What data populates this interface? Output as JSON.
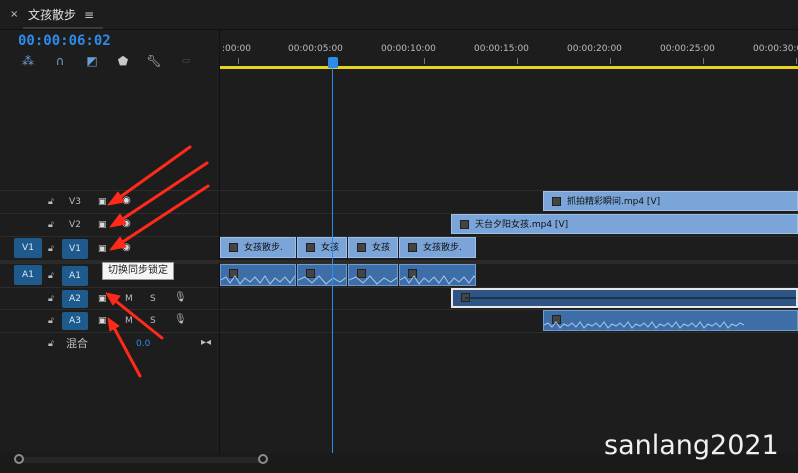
{
  "panel": {
    "close_icon": "×",
    "title": "文孩散步",
    "menu_icon": "≡"
  },
  "timecode": "00:00:06:02",
  "toolbar": {
    "icons": [
      "insert-overwrite-icon",
      "snap-magnet-icon",
      "linked-selection-icon",
      "add-marker-icon",
      "wrench-icon",
      "captions-icon"
    ]
  },
  "ruler": {
    "labels": [
      ":00:00",
      "00:00:05:00",
      "00:00:10:00",
      "00:00:15:00",
      "00:00:20:00",
      "00:00:25:00",
      "00:00:30:0"
    ]
  },
  "tracks": {
    "v3": {
      "name": "V3"
    },
    "v2": {
      "name": "V2"
    },
    "v1": {
      "name": "V1",
      "source": "V1"
    },
    "a1": {
      "name": "A1",
      "source": "A1"
    },
    "a2": {
      "name": "A2",
      "m": "M",
      "s": "S"
    },
    "a3": {
      "name": "A3",
      "m": "M",
      "s": "S"
    },
    "mix": {
      "label": "混合",
      "value": "0.0"
    }
  },
  "clips": {
    "v3_clip": "抓拍精彩瞬间.mp4 [V]",
    "v2_clip": "天台夕阳女孩.mp4 [V]",
    "v1_clips": [
      "女孩散步.",
      "女孩",
      "女孩",
      "女孩散步."
    ]
  },
  "tooltip": "切换同步锁定",
  "watermark": "sanlang2021",
  "colors": {
    "accent": "#2d8ceb",
    "video_clip": "#7ba4d8",
    "audio_clip": "#3d6ea8",
    "work_area": "#e7d21c",
    "annotation_arrow": "#ff2a1a"
  }
}
